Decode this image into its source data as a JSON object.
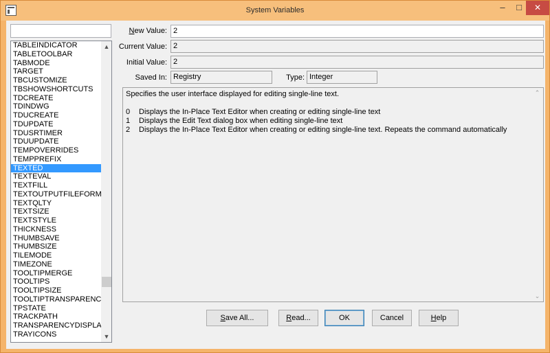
{
  "window": {
    "title": "System Variables"
  },
  "titlebar_buttons": {
    "minimize": "–",
    "maximize": "□",
    "close": "✕"
  },
  "search": {
    "value": ""
  },
  "variables": {
    "items": [
      "TABLEINDICATOR",
      "TABLETOOLBAR",
      "TABMODE",
      "TARGET",
      "TBCUSTOMIZE",
      "TBSHOWSHORTCUTS",
      "TDCREATE",
      "TDINDWG",
      "TDUCREATE",
      "TDUPDATE",
      "TDUSRTIMER",
      "TDUUPDATE",
      "TEMPOVERRIDES",
      "TEMPPREFIX",
      "TEXTED",
      "TEXTEVAL",
      "TEXTFILL",
      "TEXTOUTPUTFILEFORM.",
      "TEXTQLTY",
      "TEXTSIZE",
      "TEXTSTYLE",
      "THICKNESS",
      "THUMBSAVE",
      "THUMBSIZE",
      "TILEMODE",
      "TIMEZONE",
      "TOOLTIPMERGE",
      "TOOLTIPS",
      "TOOLTIPSIZE",
      "TOOLTIPTRANSPARENC",
      "TPSTATE",
      "TRACKPATH",
      "TRANSPARENCYDISPLAT",
      "TRAYICONS"
    ],
    "selected": "TEXTED"
  },
  "fields": {
    "new_value_label_pre": "",
    "new_value_label_ul": "N",
    "new_value_label_post": "ew Value:",
    "new_value": "2",
    "current_value_label": "Current Value:",
    "current_value": "2",
    "initial_value_label": "Initial Value:",
    "initial_value": "2",
    "saved_in_label": "Saved In:",
    "saved_in": "Registry",
    "type_label": "Type:",
    "type": "Integer"
  },
  "description": {
    "summary": "Specifies the user interface displayed for editing single-line text.",
    "options": [
      {
        "code": "0",
        "text": "Displays the In-Place Text Editor when creating or editing single-line text"
      },
      {
        "code": "1",
        "text": "Displays the Edit Text dialog box when editing single-line text"
      },
      {
        "code": "2",
        "text": "Displays the In-Place Text Editor when creating or editing single-line text. Repeats the command automatically"
      }
    ]
  },
  "buttons": {
    "save_all_ul": "S",
    "save_all_rest": "ave All...",
    "read_ul": "R",
    "read_rest": "ead...",
    "ok": "OK",
    "cancel": "Cancel",
    "help_ul": "H",
    "help_rest": "elp"
  },
  "icons": {
    "scroll_up": "▲",
    "scroll_down": "▼",
    "desc_up": "⌃",
    "desc_down": "⌄"
  }
}
